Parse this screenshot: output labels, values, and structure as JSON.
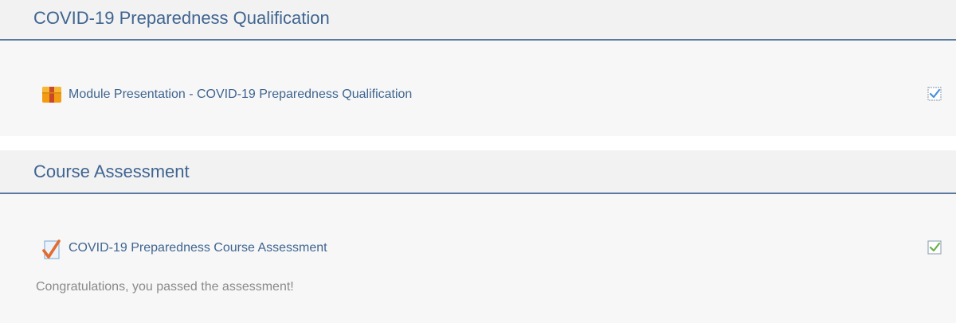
{
  "sections": [
    {
      "title": "COVID-19 Preparedness Qualification",
      "activity": {
        "label": "Module Presentation - COVID-19 Preparedness Qualification",
        "icon": "package-icon",
        "completion_icon": "checkbox-checked-blue-icon"
      }
    },
    {
      "title": "Course Assessment",
      "activity": {
        "label": "COVID-19 Preparedness Course Assessment",
        "icon": "quiz-icon",
        "completion_icon": "checkbox-checked-green-icon"
      },
      "status_message": "Congratulations, you passed the assessment!"
    }
  ],
  "colors": {
    "title": "#3f6591",
    "header_bg": "#f2f2f2",
    "body_bg": "#f7f7f7",
    "divider": "#5b7aa0",
    "check_blue": "#4a90d9",
    "check_green": "#6ab04c",
    "package_orange": "#f39c12"
  }
}
